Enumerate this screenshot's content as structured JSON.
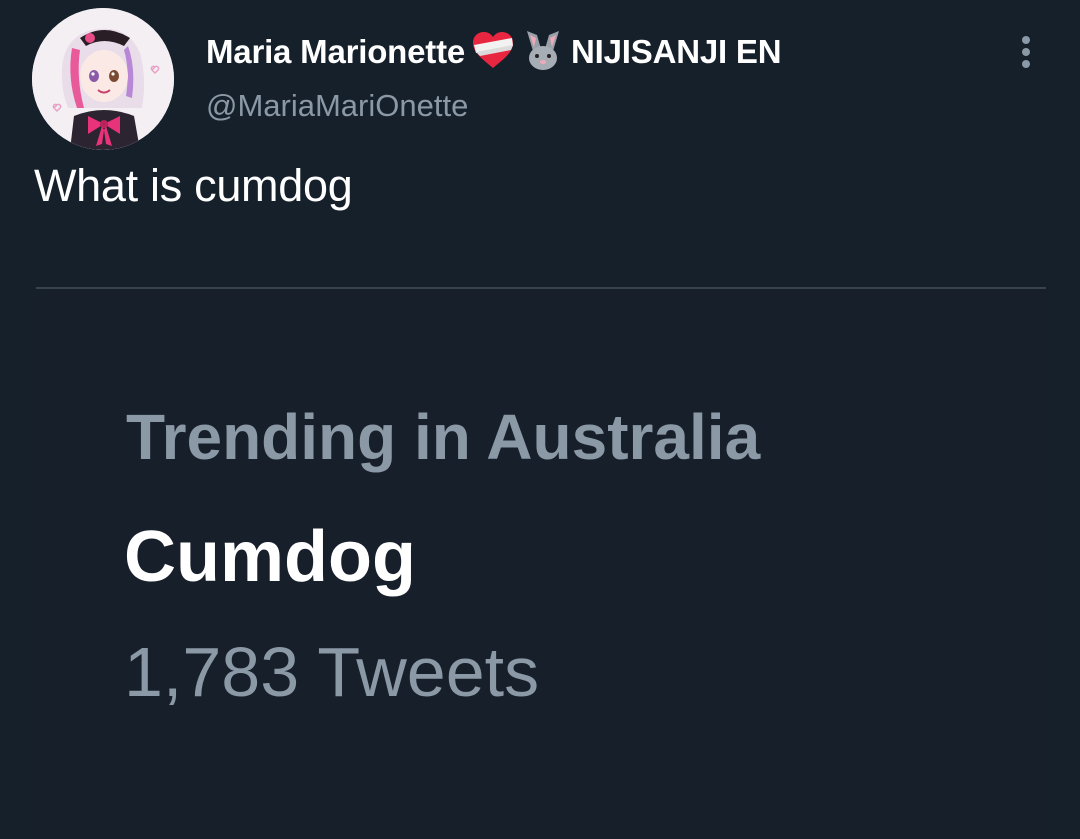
{
  "tweet": {
    "author": {
      "display_name": "Maria Marionette",
      "emojis": [
        "bandaged-heart-emoji",
        "rabbit-face-emoji"
      ],
      "org_name": "NIJISANJI EN",
      "handle": "@MariaMariOnette",
      "avatar": "anime-avatar"
    },
    "text": "What is cumdog",
    "more_icon": "more-options-icon"
  },
  "media": {
    "trend_context": "Trending in Australia",
    "trend_name": "Cumdog",
    "trend_count": "1,783 Tweets"
  },
  "colors": {
    "background": "#15202b",
    "primary_text": "#ffffff",
    "secondary_text": "#8b98a5",
    "divider": "#38444d",
    "accent_pink": "#e83e79"
  }
}
